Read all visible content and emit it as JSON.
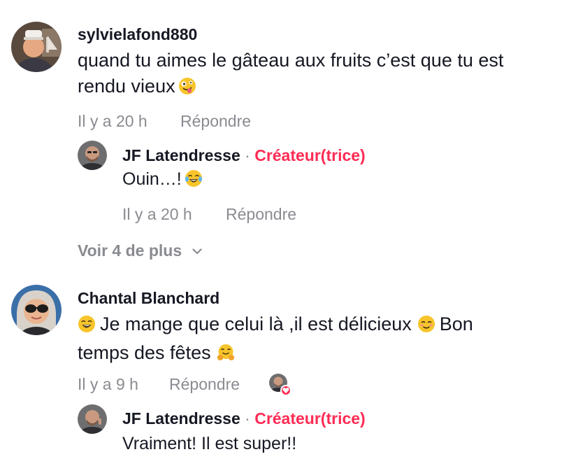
{
  "comments": [
    {
      "username": "sylvielafond880",
      "text_line1": "quand tu aimes le gâteau aux fruits c’est que tu est",
      "text_line2": "rendu vieux",
      "emoji": "zany-face",
      "time": "Il y a 20 h",
      "reply_label": "Répondre",
      "replies": [
        {
          "username": "JF Latendresse",
          "separator": "·",
          "badge": "Créateur(trice)",
          "text": "Ouin…!",
          "emoji": "tears-of-joy",
          "time": "Il y a 20 h",
          "reply_label": "Répondre"
        }
      ],
      "more_label": "Voir 4 de plus"
    },
    {
      "username": "Chantal Blanchard",
      "text_line1": "Je mange que celui là ,il est délicieux",
      "text_line1_tail": "Bon",
      "text_line2": "temps des fêtes",
      "emojis": [
        "grinning-face",
        "smiling-face",
        "hugging-face"
      ],
      "time": "Il y a 9 h",
      "reply_label": "Répondre",
      "liked_by_creator": true,
      "replies": [
        {
          "username": "JF Latendresse",
          "separator": "·",
          "badge": "Créateur(trice)",
          "text": "Vraiment! Il est super!!"
        }
      ]
    }
  ],
  "colors": {
    "creator_badge": "#fe2c55",
    "meta": "#8a8b91",
    "text": "#161823",
    "emoji": "#f7c52b"
  }
}
